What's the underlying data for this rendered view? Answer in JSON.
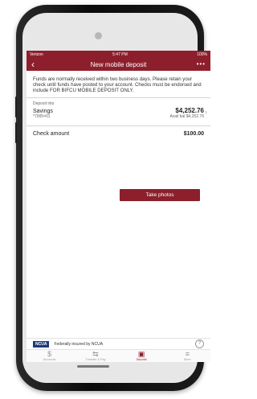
{
  "status_bar": {
    "carrier": "Verizon",
    "time": "5:47 PM",
    "battery": "100%"
  },
  "nav": {
    "title": "New mobile deposit",
    "back_icon": "chevron-left-icon",
    "more_icon": "ellipsis-icon"
  },
  "notice": "Funds are normally received within two business days. Please retain your check until funds have posted to your account. Checks must be endorsed and include FOR BIFCU MOBILE DEPOSIT ONLY.",
  "deposit_into": {
    "label": "Deposit into",
    "account_name": "Savings",
    "account_number": "*7005=01",
    "balance": "$4,252.76",
    "available": "Avail bal $4,252.76"
  },
  "check": {
    "label": "Check amount",
    "amount": "$100.00"
  },
  "take_photos_label": "Take photos",
  "ncua": {
    "logo": "NCUA",
    "text": "Federally insured by NCUA",
    "help": "?"
  },
  "tabs": [
    {
      "label": "Accounts",
      "icon": "$"
    },
    {
      "label": "Transfer & Pay",
      "icon": "⇆"
    },
    {
      "label": "Deposit",
      "icon": "▣"
    },
    {
      "label": "More",
      "icon": "≡"
    }
  ],
  "colors": {
    "brand": "#8d1f2c"
  }
}
